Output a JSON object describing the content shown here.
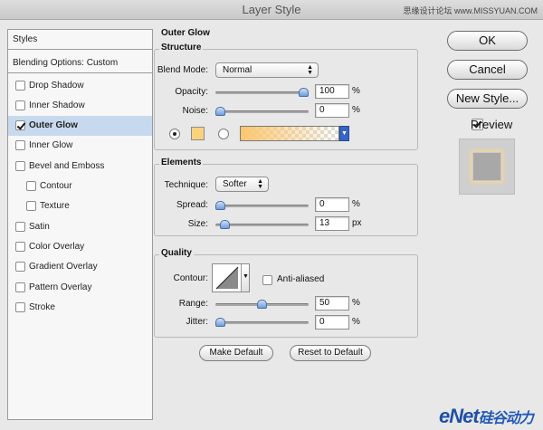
{
  "window": {
    "title": "Layer Style",
    "watermark": "思缘设计论坛 www.MISSYUAN.COM"
  },
  "left_panel": {
    "header_styles": "Styles",
    "header_blending": "Blending Options: Custom",
    "items": [
      {
        "label": "Drop Shadow",
        "checked": false
      },
      {
        "label": "Inner Shadow",
        "checked": false
      },
      {
        "label": "Outer Glow",
        "checked": true,
        "selected": true
      },
      {
        "label": "Inner Glow",
        "checked": false
      },
      {
        "label": "Bevel and Emboss",
        "checked": false
      },
      {
        "label": "Contour",
        "checked": false
      },
      {
        "label": "Texture",
        "checked": false
      },
      {
        "label": "Satin",
        "checked": false
      },
      {
        "label": "Color Overlay",
        "checked": false
      },
      {
        "label": "Gradient Overlay",
        "checked": false
      },
      {
        "label": "Pattern Overlay",
        "checked": false
      },
      {
        "label": "Stroke",
        "checked": false
      }
    ]
  },
  "outer_glow": {
    "title": "Outer Glow",
    "structure": {
      "title": "Structure",
      "blend_mode_label": "Blend Mode:",
      "blend_mode_value": "Normal",
      "opacity_label": "Opacity:",
      "opacity_value": "100",
      "opacity_fraction": 1.0,
      "noise_label": "Noise:",
      "noise_value": "0",
      "noise_fraction": 0.0,
      "percent_unit": "%",
      "color_mode": "solid",
      "glow_color": "#f9d27f",
      "gradient_color": "#fcc66f"
    },
    "elements": {
      "title": "Elements",
      "technique_label": "Technique:",
      "technique_value": "Softer",
      "spread_label": "Spread:",
      "spread_value": "0",
      "spread_fraction": 0.0,
      "size_label": "Size:",
      "size_value": "13",
      "size_fraction": 0.052,
      "px_unit": "px",
      "percent_unit": "%"
    },
    "quality": {
      "title": "Quality",
      "contour_label": "Contour:",
      "anti_aliased_label": "Anti-aliased",
      "anti_aliased": false,
      "range_label": "Range:",
      "range_value": "50",
      "range_fraction": 0.5,
      "jitter_label": "Jitter:",
      "jitter_value": "0",
      "jitter_fraction": 0.0,
      "percent_unit": "%"
    },
    "make_default_label": "Make Default",
    "reset_default_label": "Reset to Default"
  },
  "right_panel": {
    "ok_label": "OK",
    "cancel_label": "Cancel",
    "new_style_label": "New Style...",
    "preview_label": "Preview",
    "preview_checked": true
  },
  "footer": {
    "logo_latin": "eNet",
    "logo_cjk": "硅谷动力"
  }
}
